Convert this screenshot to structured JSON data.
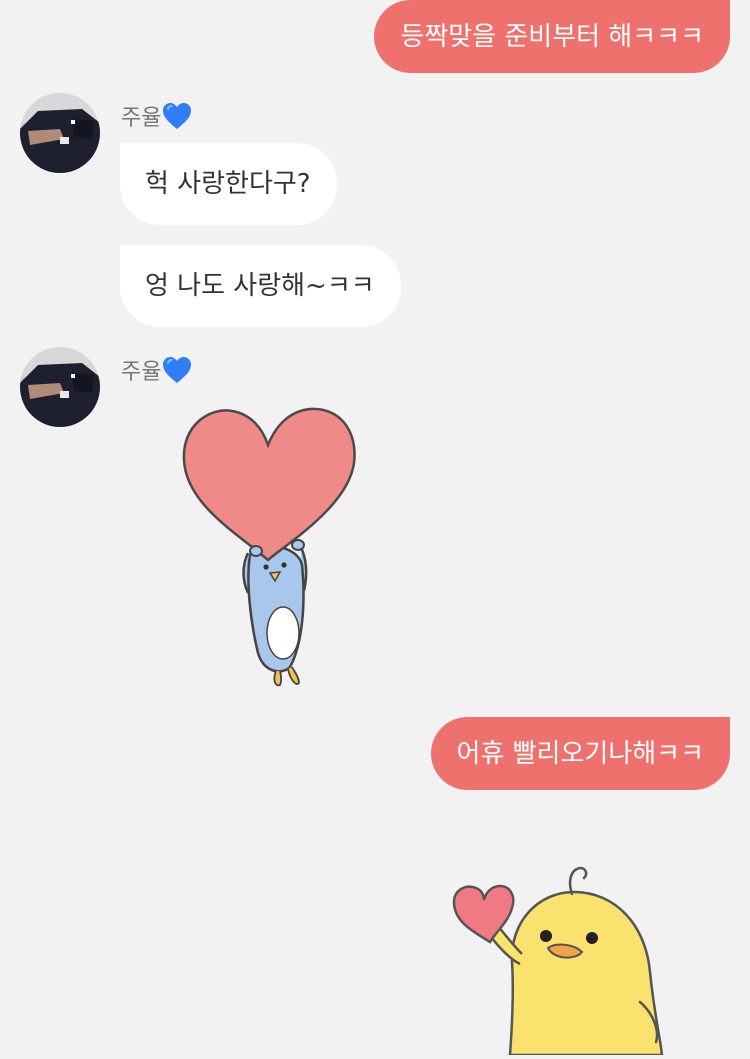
{
  "colors": {
    "background": "#f2f2f2",
    "outgoing_bubble": "#ef716e",
    "incoming_bubble": "#ffffff",
    "sender_name": "#777777",
    "heart_emoji": "#2f7ef5"
  },
  "messages": [
    {
      "direction": "outgoing",
      "text": "등짝맞을 준비부터 해ㅋㅋㅋ"
    },
    {
      "direction": "incoming",
      "sender": "주율",
      "sender_emoji": "blue-heart-icon",
      "text": "헉 사랑한다구?"
    },
    {
      "direction": "incoming",
      "text": "엉 나도 사랑해~ㅋㅋ"
    },
    {
      "direction": "incoming",
      "sender": "주율",
      "sender_emoji": "blue-heart-icon",
      "sticker": "penguin-holding-heart-sticker"
    },
    {
      "direction": "outgoing",
      "text": "어휴 빨리오기나해ㅋㅋ"
    },
    {
      "direction": "outgoing",
      "sticker": "yellow-chick-heart-sticker"
    }
  ]
}
